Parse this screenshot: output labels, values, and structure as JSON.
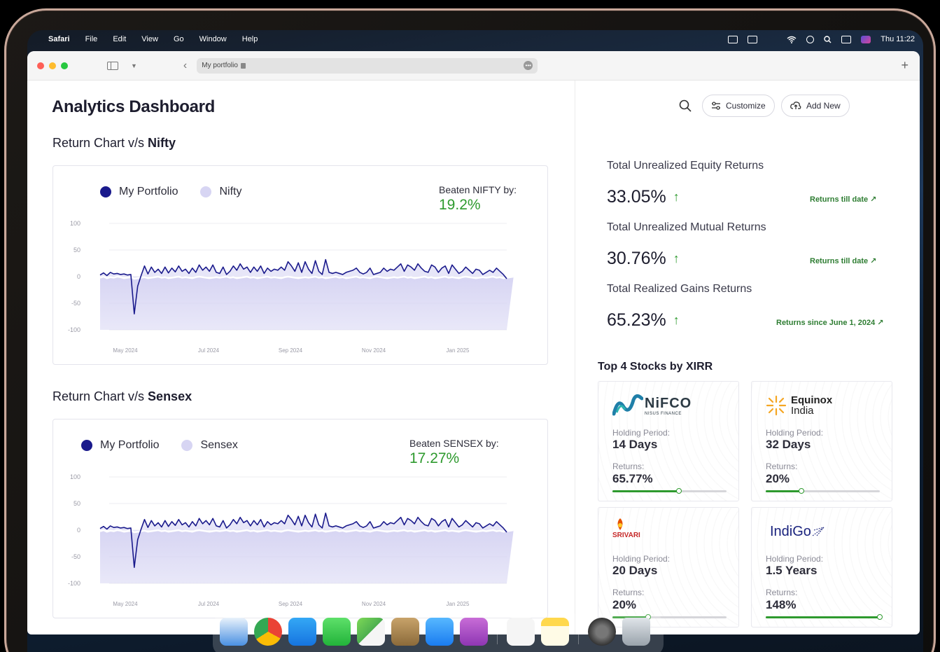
{
  "menubar": {
    "app_name": "Safari",
    "items": [
      "File",
      "Edit",
      "View",
      "Go",
      "Window",
      "Help"
    ],
    "clock": "Thu 11:22"
  },
  "browser": {
    "url": "My portfolio",
    "new_tab_label": "+"
  },
  "page": {
    "title": "Analytics Dashboard"
  },
  "charts": [
    {
      "section_prefix": "Return Chart v/s ",
      "section_bold": "Nifty",
      "legend": [
        "My Portfolio",
        "Nifty"
      ],
      "beaten_label": "Beaten NIFTY by:",
      "beaten_value": "19.2%"
    },
    {
      "section_prefix": "Return Chart v/s ",
      "section_bold": "Sensex",
      "legend": [
        "My Portfolio",
        "Sensex"
      ],
      "beaten_label": "Beaten SENSEX by:",
      "beaten_value": "17.27%"
    }
  ],
  "chart_data": [
    {
      "type": "area",
      "ylim": [
        -100,
        100
      ],
      "yticks": [
        "100",
        "50",
        "0",
        "-50",
        "-100"
      ],
      "xticks": [
        "May 2024",
        "Jul 2024",
        "Sep 2024",
        "Nov 2024",
        "Jan 2025"
      ],
      "colors": {
        "portfolio": "#1a1a8c",
        "benchmark": "#d7d5f3"
      },
      "series": [
        {
          "name": "My Portfolio",
          "values": [
            3,
            7,
            2,
            8,
            5,
            6,
            4,
            5,
            3,
            4,
            -70,
            -18,
            2,
            20,
            5,
            18,
            8,
            14,
            6,
            18,
            7,
            16,
            9,
            20,
            10,
            14,
            6,
            16,
            8,
            22,
            12,
            18,
            10,
            22,
            8,
            6,
            18,
            4,
            10,
            20,
            12,
            24,
            14,
            18,
            8,
            18,
            10,
            20,
            6,
            16,
            10,
            14,
            12,
            18,
            12,
            28,
            20,
            10,
            26,
            8,
            28,
            14,
            6,
            30,
            10,
            4,
            32,
            8,
            6,
            8,
            6,
            4,
            8,
            10,
            12,
            16,
            8,
            5,
            8,
            16,
            4,
            6,
            8,
            16,
            10,
            14,
            12,
            18,
            24,
            10,
            22,
            18,
            12,
            24,
            16,
            10,
            8,
            22,
            18,
            8,
            16,
            20,
            6,
            22,
            14,
            6,
            10,
            18,
            12,
            6,
            14,
            12,
            4,
            8,
            12,
            8,
            16,
            10,
            4,
            -4
          ]
        },
        {
          "name": "Nifty",
          "values": [
            -2,
            0,
            -3,
            -1,
            -2,
            0,
            -1,
            -3,
            -2,
            -1,
            -4,
            -3,
            -2,
            -1,
            -3,
            -2,
            -1,
            0,
            -2,
            -1,
            -3,
            -2,
            -1,
            0,
            -2,
            -1,
            -2,
            -3,
            -1,
            0,
            -1,
            -2,
            -3,
            -2,
            -1,
            -2,
            -1,
            0,
            -2,
            -1,
            -3,
            -2,
            -1,
            0,
            -2,
            -1,
            -3,
            -2,
            -1,
            0,
            -2,
            -1,
            -2,
            -3,
            -1,
            0,
            -1,
            -2,
            -3,
            -2,
            -1,
            -2,
            -1,
            0,
            -2,
            -1,
            -3,
            -2,
            -1,
            0,
            -2,
            -1,
            -3,
            -2,
            -1,
            0,
            -2,
            -1,
            -2,
            -3,
            -1,
            0,
            -1,
            -2,
            -3,
            -2,
            -1,
            -2,
            -1,
            0,
            -2,
            -1,
            -3,
            -2,
            -1,
            0,
            -2,
            -1,
            -3,
            -2,
            -1,
            0,
            -2,
            -1,
            -2,
            -3,
            -1,
            0,
            -1,
            -2,
            -3,
            -2,
            -1,
            -2,
            -1,
            0,
            -2,
            -1,
            -3,
            -2,
            -1,
            0
          ]
        }
      ]
    },
    {
      "type": "area",
      "ylim": [
        -100,
        100
      ],
      "yticks": [
        "100",
        "50",
        "0",
        "-50",
        "-100"
      ],
      "xticks": [
        "May 2024",
        "Jul 2024",
        "Sep 2024",
        "Nov 2024",
        "Jan 2025"
      ],
      "colors": {
        "portfolio": "#1a1a8c",
        "benchmark": "#d7d5f3"
      },
      "series": [
        {
          "name": "My Portfolio",
          "values": [
            3,
            7,
            2,
            8,
            5,
            6,
            4,
            5,
            3,
            4,
            -70,
            -18,
            2,
            20,
            5,
            18,
            8,
            14,
            6,
            18,
            7,
            16,
            9,
            20,
            10,
            14,
            6,
            16,
            8,
            22,
            12,
            18,
            10,
            22,
            8,
            6,
            18,
            4,
            10,
            20,
            12,
            24,
            14,
            18,
            8,
            18,
            10,
            20,
            6,
            16,
            10,
            14,
            12,
            18,
            12,
            28,
            20,
            10,
            26,
            8,
            28,
            14,
            6,
            30,
            10,
            4,
            32,
            8,
            6,
            8,
            6,
            4,
            8,
            10,
            12,
            16,
            8,
            5,
            8,
            16,
            4,
            6,
            8,
            16,
            10,
            14,
            12,
            18,
            24,
            10,
            22,
            18,
            12,
            24,
            16,
            10,
            8,
            22,
            18,
            8,
            16,
            20,
            6,
            22,
            14,
            6,
            10,
            18,
            12,
            6,
            14,
            12,
            4,
            8,
            12,
            8,
            16,
            10,
            4,
            -4
          ]
        },
        {
          "name": "Sensex",
          "values": [
            -2,
            0,
            -3,
            -1,
            -2,
            0,
            -1,
            -3,
            -2,
            -1,
            -4,
            -3,
            -2,
            -1,
            -3,
            -2,
            -1,
            0,
            -2,
            -1,
            -3,
            -2,
            -1,
            0,
            -2,
            -1,
            -2,
            -3,
            -1,
            0,
            -1,
            -2,
            -3,
            -2,
            -1,
            -2,
            -1,
            0,
            -2,
            -1,
            -3,
            -2,
            -1,
            0,
            -2,
            -1,
            -3,
            -2,
            -1,
            0,
            -2,
            -1,
            -2,
            -3,
            -1,
            0,
            -1,
            -2,
            -3,
            -2,
            -1,
            -2,
            -1,
            0,
            -2,
            -1,
            -3,
            -2,
            -1,
            0,
            -2,
            -1,
            -3,
            -2,
            -1,
            0,
            -2,
            -1,
            -2,
            -3,
            -1,
            0,
            -1,
            -2,
            -3,
            -2,
            -1,
            -2,
            -1,
            0,
            -2,
            -1,
            -3,
            -2,
            -1,
            0,
            -2,
            -1,
            -3,
            -2,
            -1,
            0,
            -2,
            -1,
            -2,
            -3,
            -1,
            0,
            -1,
            -2,
            -3,
            -2,
            -1,
            -2,
            -1,
            0,
            -2,
            -1,
            -3,
            -2,
            -1,
            0
          ]
        }
      ]
    }
  ],
  "actions": {
    "customize_label": "Customize",
    "add_new_label": "Add New"
  },
  "metrics": [
    {
      "label": "Total Unrealized Equity Returns",
      "value": "33.05%",
      "link": "Returns till date ↗"
    },
    {
      "label": "Total Unrealized Mutual Returns",
      "value": "30.76%",
      "link": "Returns till date ↗"
    },
    {
      "label": "Total Realized Gains Returns",
      "value": "65.23%",
      "link": "Returns since June 1, 2024 ↗"
    }
  ],
  "stocks_title": "Top 4 Stocks by XIRR",
  "stocks": [
    {
      "logo": "NiFCO",
      "logo_sub": "NISUS FINANCE",
      "holding_label": "Holding Period:",
      "holding": "14 Days",
      "returns_label": "Returns:",
      "returns": "65.77%",
      "progress": 0.58
    },
    {
      "logo": "Equinox",
      "logo_sub": "India",
      "holding_label": "Holding Period:",
      "holding": "32 Days",
      "returns_label": "Returns:",
      "returns": "20%",
      "progress": 0.31
    },
    {
      "logo": "SRIVARI",
      "logo_sub": "",
      "holding_label": "Holding Period:",
      "holding": "20 Days",
      "returns_label": "Returns:",
      "returns": "20%",
      "progress": 0.31
    },
    {
      "logo": "IndiGo",
      "logo_sub": "",
      "holding_label": "Holding Period:",
      "holding": "1.5 Years",
      "returns_label": "Returns:",
      "returns": "148%",
      "progress": 1.0
    }
  ]
}
